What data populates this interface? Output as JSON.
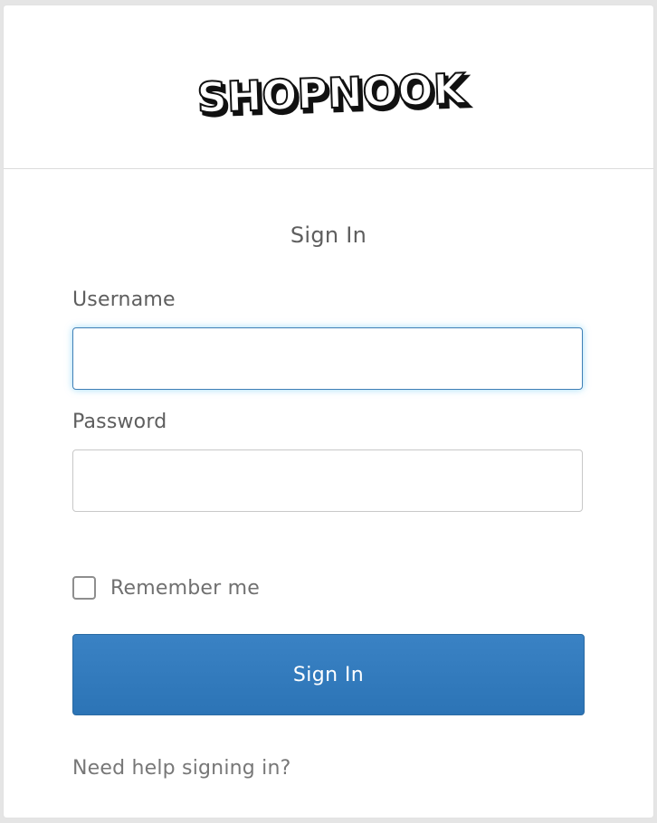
{
  "header": {
    "logo_text": "SHOPNOOK"
  },
  "form": {
    "title": "Sign In",
    "username": {
      "label": "Username",
      "value": "",
      "placeholder": ""
    },
    "password": {
      "label": "Password",
      "value": "",
      "placeholder": ""
    },
    "remember_me": {
      "label": "Remember me",
      "checked": false
    },
    "submit_label": "Sign In",
    "help_link": "Need help signing in?"
  },
  "colors": {
    "page_background": "#e5e5e5",
    "card_background": "#ffffff",
    "primary_button": "#2f78b8",
    "focus_glow": "#50bef0",
    "text_gray": "#5e5e5e"
  }
}
